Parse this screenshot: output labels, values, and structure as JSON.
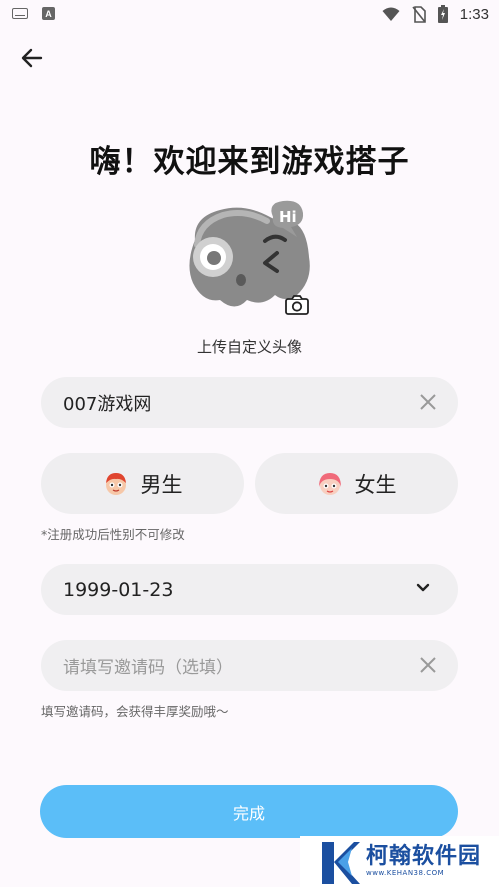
{
  "status_bar": {
    "time": "1:33",
    "left_icons": [
      "keyboard-icon",
      "a-notification-icon"
    ],
    "right_icons": [
      "wifi-icon",
      "no-sim-icon",
      "battery-icon"
    ]
  },
  "header": {
    "title": "嗨！欢迎来到游戏搭子"
  },
  "avatar": {
    "caption": "上传自定义头像",
    "badge_text": "Hi"
  },
  "nickname": {
    "value": "007游戏网"
  },
  "gender": {
    "male_label": "男生",
    "female_label": "女生",
    "note": "*注册成功后性别不可修改"
  },
  "birthday": {
    "value": "1999-01-23"
  },
  "invite": {
    "placeholder": "请填写邀请码（选填）",
    "note": "填写邀请码，会获得丰厚奖励哦～"
  },
  "submit": {
    "label": "完成"
  },
  "watermark": {
    "title": "柯翰软件园",
    "subtitle": "www.KEHAN38.COM"
  },
  "colors": {
    "primary_button": "#5bbef8",
    "field_bg": "#f0eff1",
    "page_bg": "#fdf9fd"
  }
}
